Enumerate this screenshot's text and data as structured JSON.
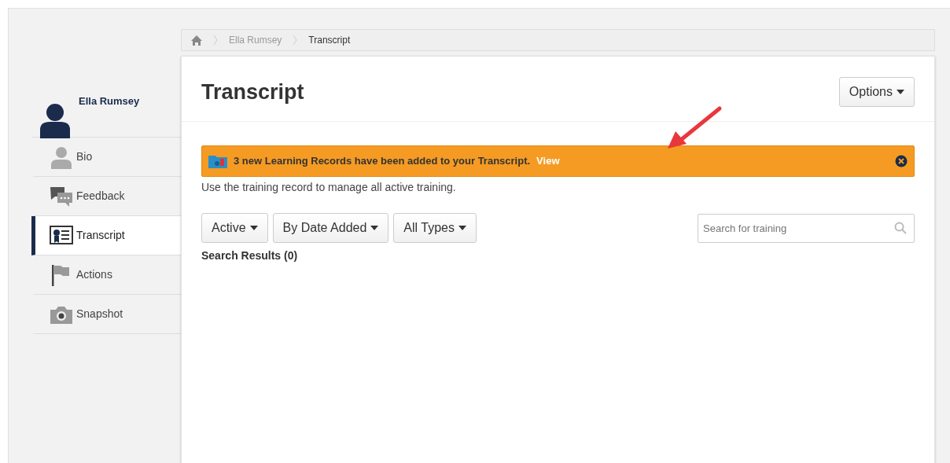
{
  "breadcrumb": [
    "Ella Rumsey",
    "Transcript"
  ],
  "profile": {
    "name": "Ella Rumsey"
  },
  "sidebar": {
    "items": [
      {
        "label": "Bio",
        "kind": "bio",
        "selected": false
      },
      {
        "label": "Feedback",
        "kind": "feedback",
        "selected": false
      },
      {
        "label": "Transcript",
        "kind": "transcript",
        "selected": true
      },
      {
        "label": "Actions",
        "kind": "actions",
        "selected": false
      },
      {
        "label": "Snapshot",
        "kind": "snapshot",
        "selected": false
      }
    ]
  },
  "page": {
    "title": "Transcript",
    "options_button": "Options"
  },
  "alert": {
    "message": "3 new Learning Records have been added to your Transcript.",
    "link": "View"
  },
  "description": "Use the training record to manage all active training.",
  "filters": [
    "Active",
    "By Date Added",
    "All Types"
  ],
  "search": {
    "placeholder": "Search for training"
  },
  "results": "Search Results (0)"
}
